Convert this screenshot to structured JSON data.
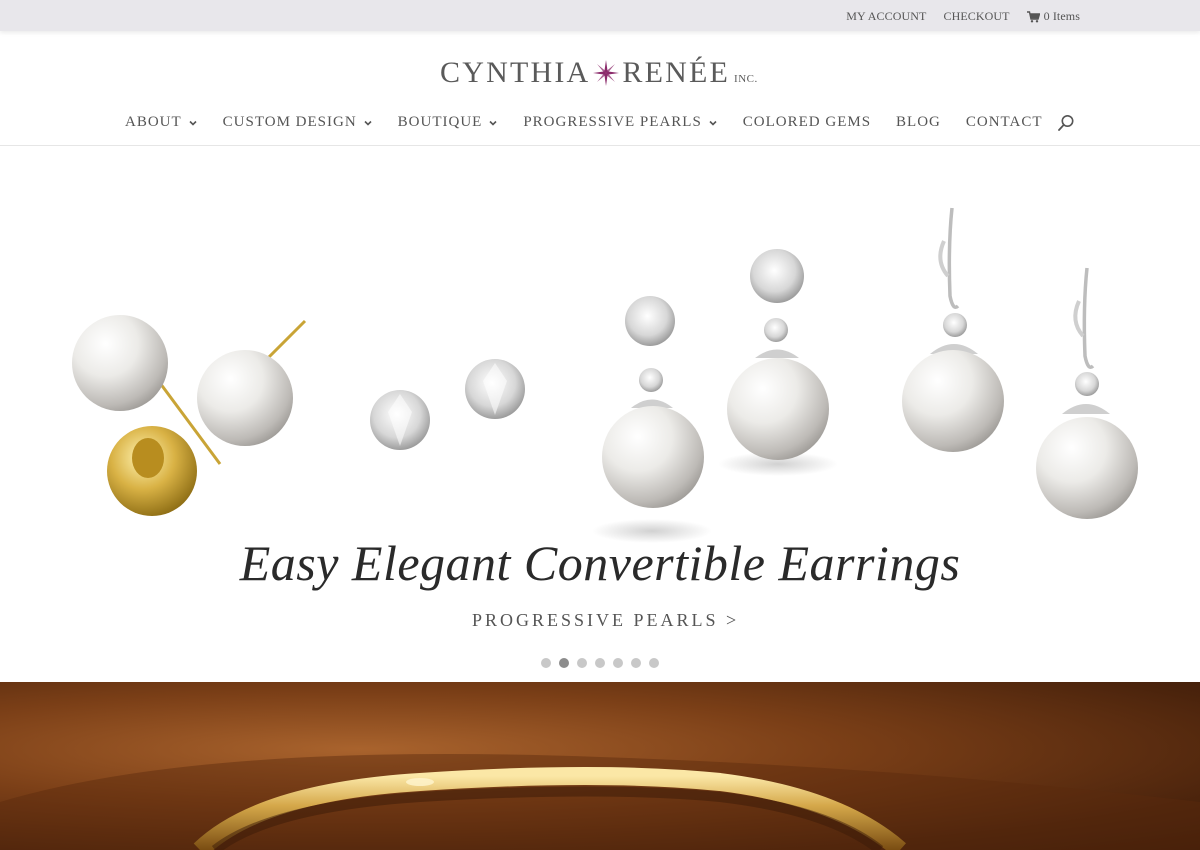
{
  "topbar": {
    "my_account": "MY ACCOUNT",
    "checkout": "CHECKOUT",
    "cart_label": "0 Items",
    "cart_icon": "cart-icon"
  },
  "logo": {
    "word1": "CYNTHIA",
    "word2": "RENÉE",
    "inc": "INC."
  },
  "nav": {
    "items": [
      {
        "label": "ABOUT",
        "has_dropdown": true
      },
      {
        "label": "CUSTOM DESIGN",
        "has_dropdown": true
      },
      {
        "label": "BOUTIQUE",
        "has_dropdown": true
      },
      {
        "label": "PROGRESSIVE PEARLS",
        "has_dropdown": true
      },
      {
        "label": "COLORED GEMS",
        "has_dropdown": false
      },
      {
        "label": "BLOG",
        "has_dropdown": false
      },
      {
        "label": "CONTACT",
        "has_dropdown": false
      }
    ],
    "search_icon": "search-icon"
  },
  "hero": {
    "title": "Easy Elegant Convertible Earrings",
    "cta": "PROGRESSIVE PEARLS >",
    "slide_count": 7,
    "active_slide": 2
  },
  "colors": {
    "topbar_bg": "#e8e7eb",
    "brand_star": "#8b2a6b",
    "text": "#555555"
  }
}
